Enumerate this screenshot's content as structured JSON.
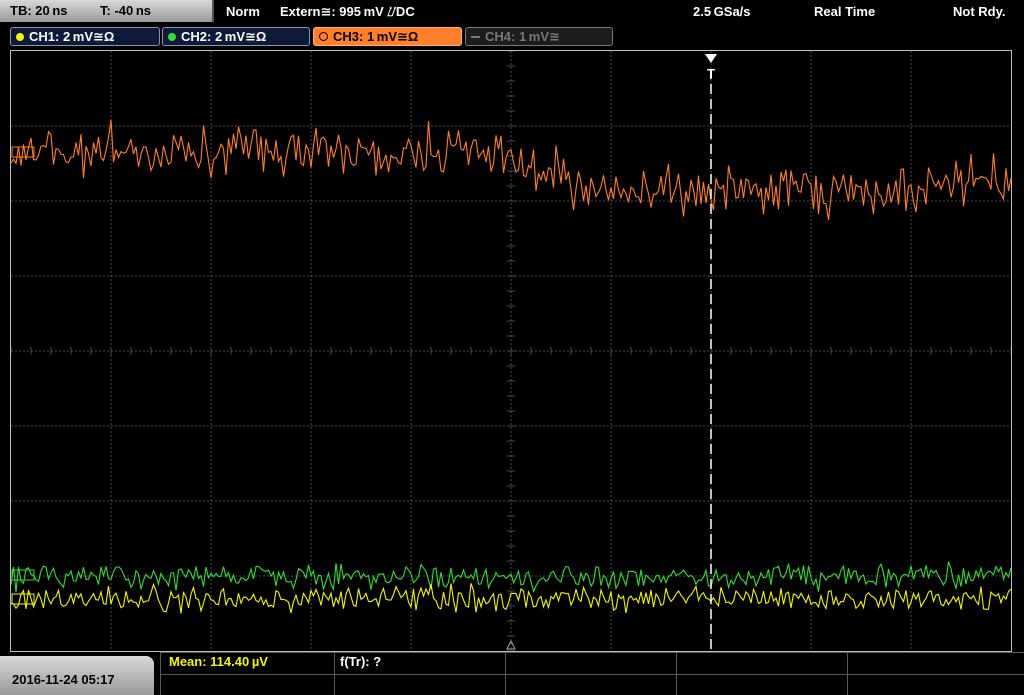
{
  "header": {
    "timebase": "TB: 20 ns",
    "trigger_time": "T: -40 ns",
    "mode": "Norm",
    "trigger_source": "Extern≅: 995 mV ⌰DC",
    "sample_rate": "2.5 GSa/s",
    "acq_mode": "Real Time",
    "status": "Not Rdy."
  },
  "channels": [
    {
      "label": "CH1: 2 mV≅Ω",
      "color": "#f5f500",
      "active": false
    },
    {
      "label": "CH2: 2 mV≅Ω",
      "color": "#33dd33",
      "active": false
    },
    {
      "label": "CH3: 1 mV≅Ω",
      "color": "#ff7f2a",
      "active": true
    },
    {
      "label": "CH4: 1 mV≅",
      "color": "#888888",
      "active": false
    }
  ],
  "trigger_marker": "T",
  "footer": {
    "datetime": "2016-11-24 05:17",
    "mean": "Mean: 114.40 µV",
    "ftr": "f(Tr): ?"
  },
  "colors": {
    "ch1": "#f5f500",
    "ch2": "#33dd33",
    "ch3": "#ff7f2a",
    "ch4": "#888888",
    "grid": "#4a4a4a"
  }
}
